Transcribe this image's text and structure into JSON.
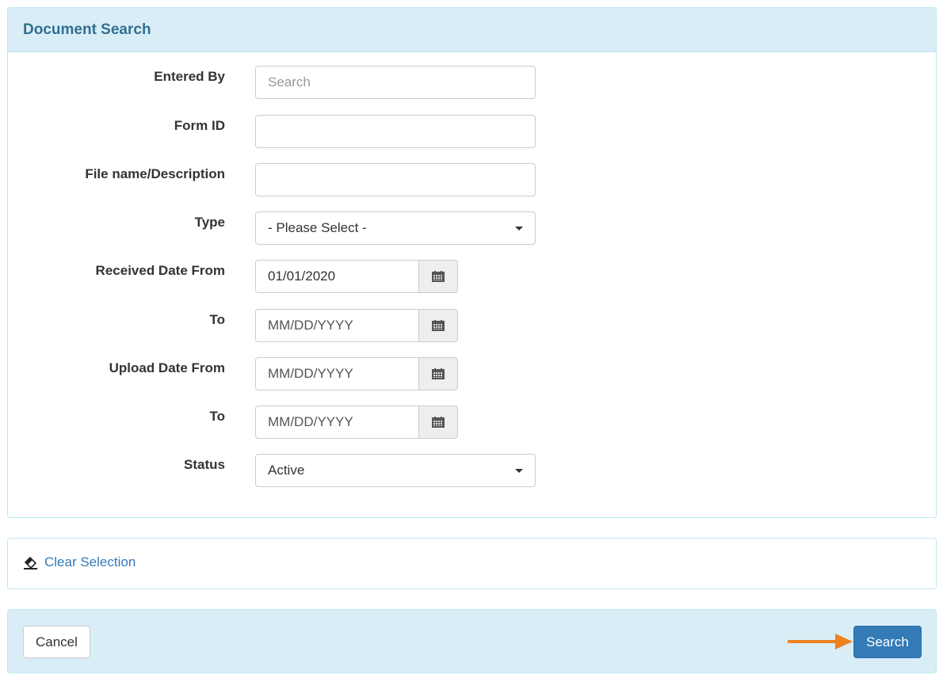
{
  "panel": {
    "title": "Document Search"
  },
  "form": {
    "entered_by": {
      "label": "Entered By",
      "value": "",
      "placeholder": "Search"
    },
    "form_id": {
      "label": "Form ID",
      "value": ""
    },
    "file_name": {
      "label": "File name/Description",
      "value": ""
    },
    "type": {
      "label": "Type",
      "selected": "- Please Select -"
    },
    "received_from": {
      "label": "Received Date From",
      "value": "01/01/2020"
    },
    "received_to": {
      "label": "To",
      "placeholder": "MM/DD/YYYY"
    },
    "upload_from": {
      "label": "Upload Date From",
      "placeholder": "MM/DD/YYYY"
    },
    "upload_to": {
      "label": "To",
      "placeholder": "MM/DD/YYYY"
    },
    "status": {
      "label": "Status",
      "selected": "Active"
    }
  },
  "actions": {
    "clear_label": "Clear Selection",
    "cancel_label": "Cancel",
    "search_label": "Search",
    "arrow_color": "#f0811f"
  }
}
